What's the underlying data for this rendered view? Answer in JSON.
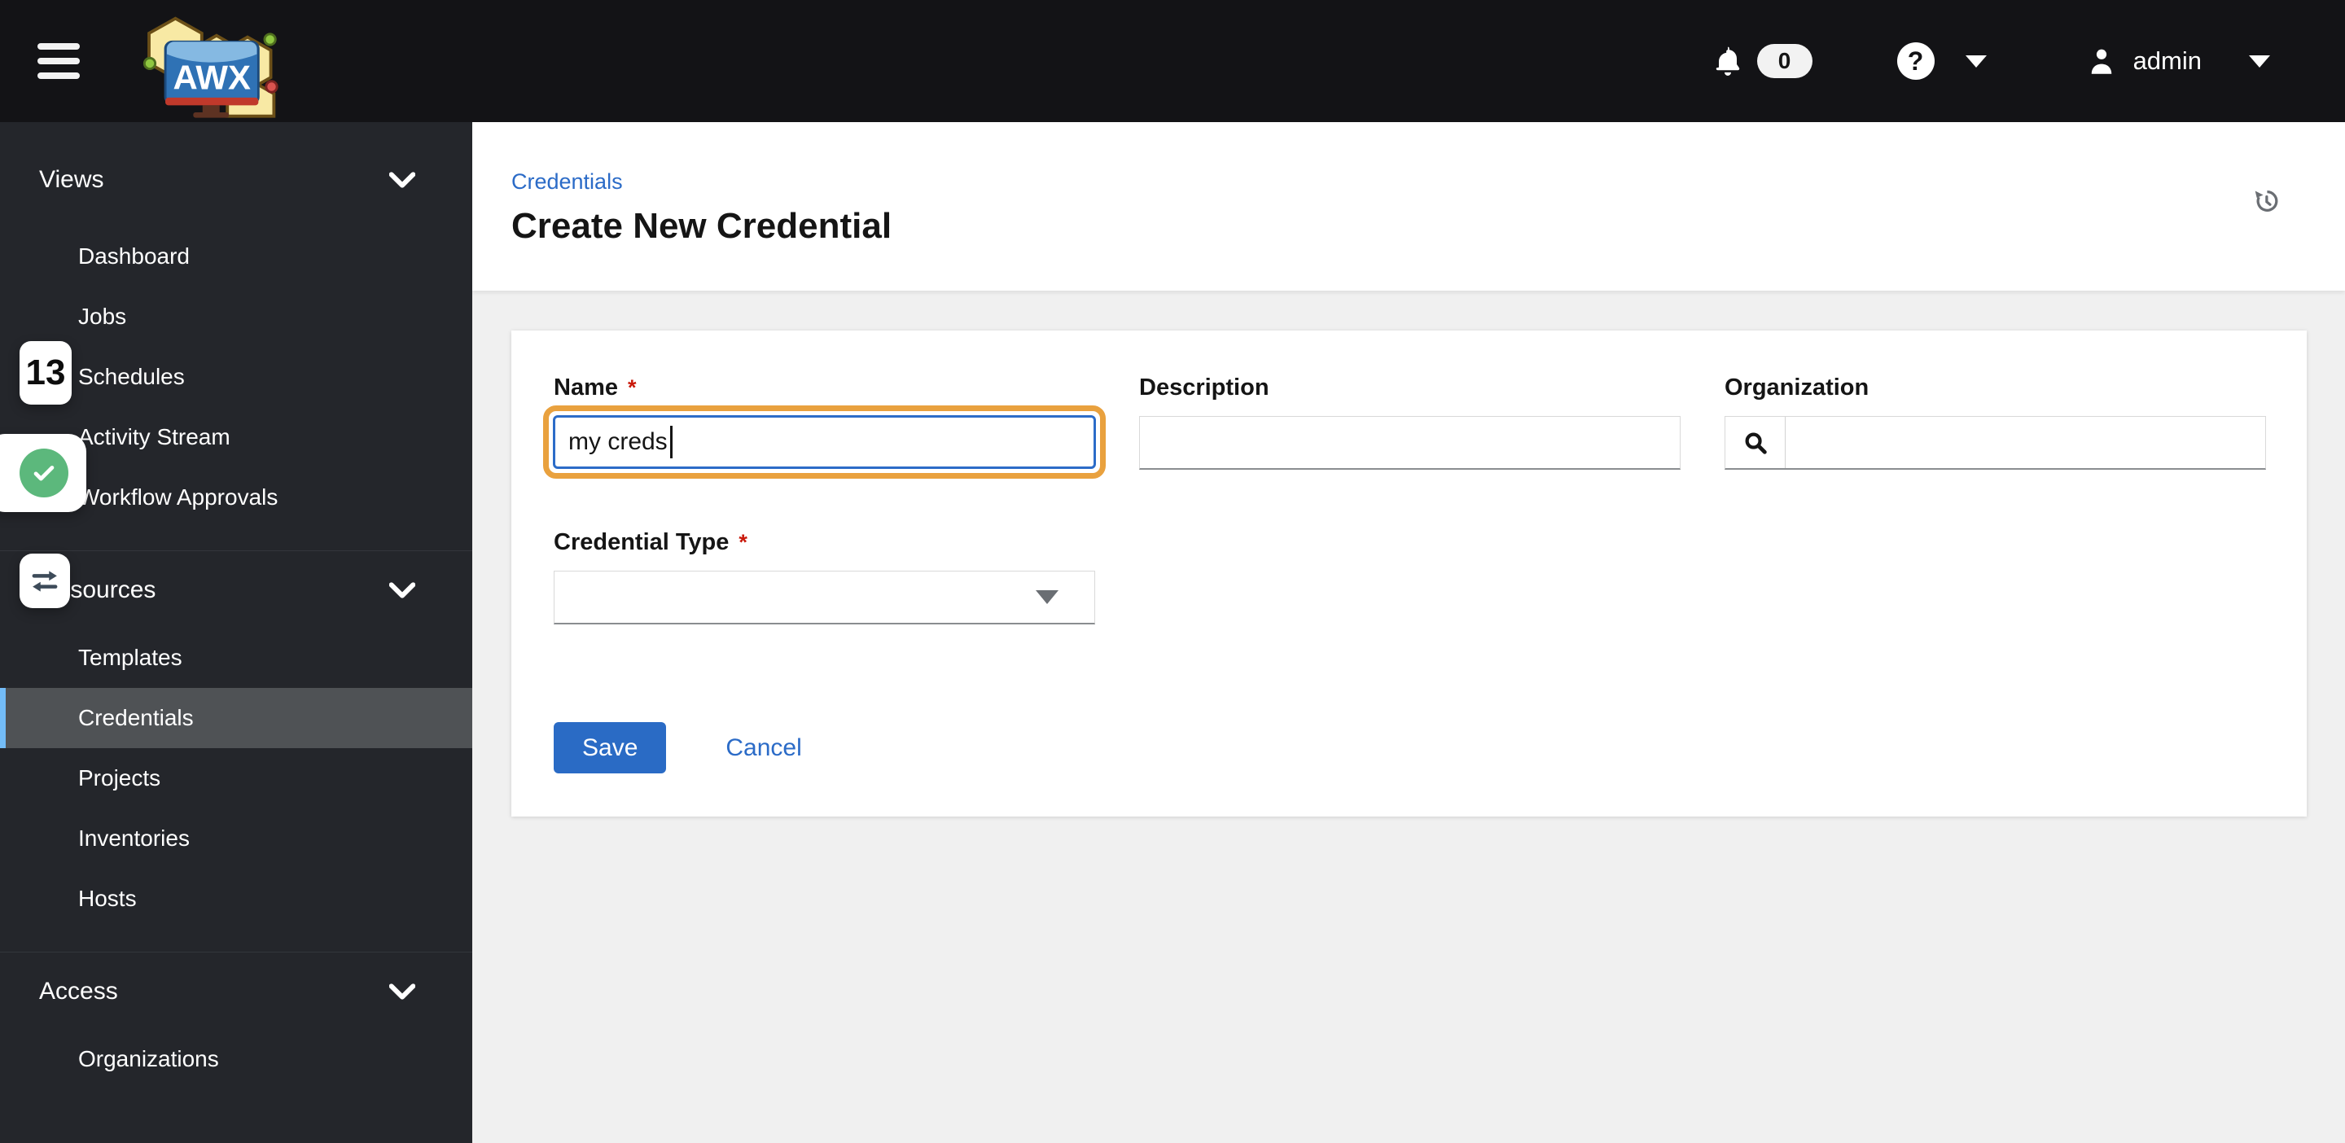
{
  "topbar": {
    "brand": "AWX",
    "help_glyph": "?",
    "notification_count": "0",
    "username": "admin"
  },
  "sidebar": {
    "sections": [
      {
        "label": "Views",
        "items": [
          {
            "label": "Dashboard"
          },
          {
            "label": "Jobs"
          },
          {
            "label": "Schedules"
          },
          {
            "label": "Activity Stream"
          },
          {
            "label": "Workflow Approvals"
          }
        ]
      },
      {
        "label": "Resources",
        "items": [
          {
            "label": "Templates"
          },
          {
            "label": "Credentials",
            "active": true
          },
          {
            "label": "Projects"
          },
          {
            "label": "Inventories"
          },
          {
            "label": "Hosts"
          }
        ]
      },
      {
        "label": "Access",
        "items": [
          {
            "label": "Organizations"
          }
        ]
      }
    ]
  },
  "header": {
    "breadcrumb": "Credentials",
    "title": "Create New Credential"
  },
  "form": {
    "required_marker": "*",
    "name": {
      "label": "Name",
      "value": "my creds"
    },
    "description": {
      "label": "Description",
      "value": ""
    },
    "organization": {
      "label": "Organization",
      "value": ""
    },
    "credential_type": {
      "label": "Credential Type",
      "value": ""
    },
    "save_label": "Save",
    "cancel_label": "Cancel"
  },
  "overlays": {
    "step_badge": "13"
  },
  "colors": {
    "topbar_bg": "#131316",
    "sidebar_bg": "#24262b",
    "page_bg": "#f0f0f0",
    "accent_blue": "#2b6bc7",
    "primary_button_blue": "#2a6bc5",
    "focus_border_blue": "#2c6cc8",
    "focus_ring_orange": "#e9a13e",
    "success_green": "#5cb87c",
    "required_red": "#c9190b",
    "active_nav_bar": "#73bcf7",
    "active_nav_bg": "#4f5255"
  }
}
